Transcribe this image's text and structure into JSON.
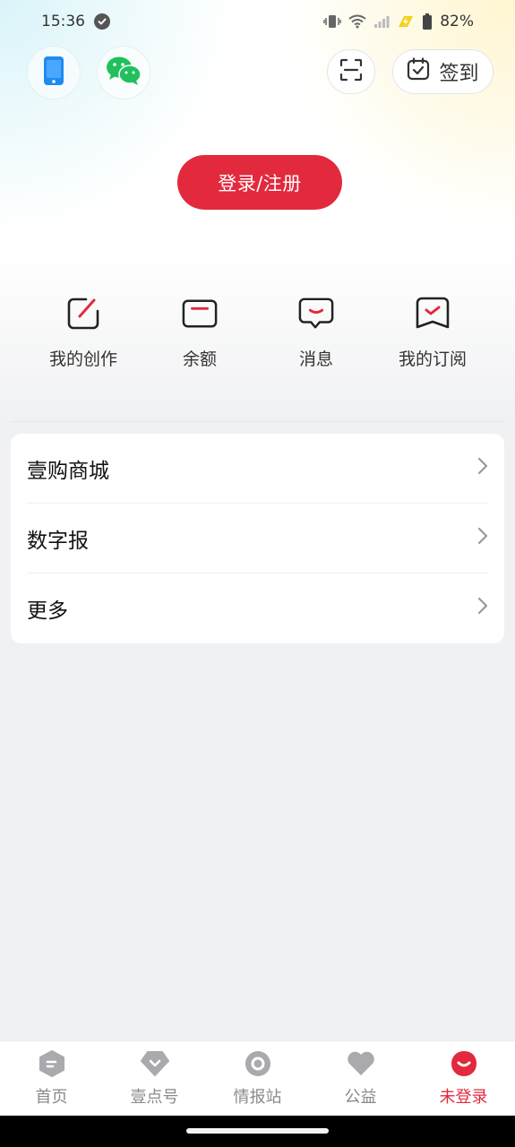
{
  "status_bar": {
    "time": "15:36",
    "battery": "82%"
  },
  "header": {
    "phone_login_icon": "phone-icon",
    "wechat_login_icon": "wechat-icon",
    "scan_icon": "scan-icon",
    "checkin_label": "签到",
    "accent_color": "#e3293d"
  },
  "login": {
    "label": "登录/注册"
  },
  "quick_actions": [
    {
      "label": "我的创作",
      "icon": "edit-icon"
    },
    {
      "label": "余额",
      "icon": "wallet-icon"
    },
    {
      "label": "消息",
      "icon": "message-icon"
    },
    {
      "label": "我的订阅",
      "icon": "subscription-icon"
    }
  ],
  "menu": [
    {
      "label": "壹购商城"
    },
    {
      "label": "数字报"
    },
    {
      "label": "更多"
    }
  ],
  "tabs": [
    {
      "label": "首页",
      "icon": "home-icon",
      "active": false
    },
    {
      "label": "壹点号",
      "icon": "yidianhao-icon",
      "active": false
    },
    {
      "label": "情报站",
      "icon": "info-station-icon",
      "active": false
    },
    {
      "label": "公益",
      "icon": "heart-icon",
      "active": false
    },
    {
      "label": "未登录",
      "icon": "profile-icon",
      "active": true
    }
  ]
}
